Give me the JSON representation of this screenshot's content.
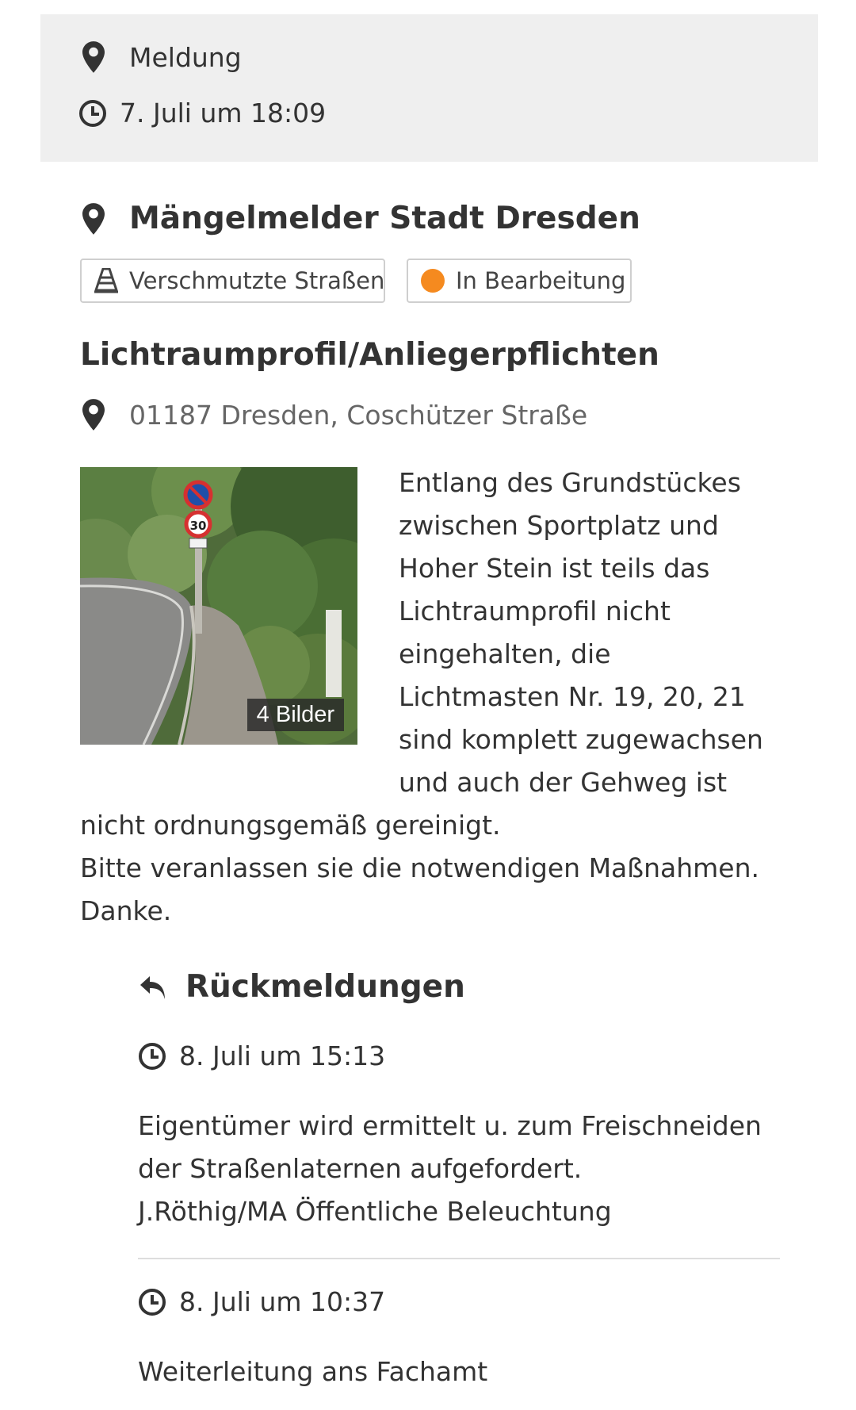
{
  "header": {
    "type_label": "Meldung",
    "type_icon": "map-pin-icon",
    "date": "7. Juli um 18:09",
    "date_icon": "clock-icon"
  },
  "org": {
    "name": "Mängelmelder Stadt Dresden",
    "icon": "map-pin-icon"
  },
  "tags": {
    "category": {
      "label": "Verschmutzte Straßen",
      "icon": "traffic-cone-icon"
    },
    "status": {
      "label": "In Bearbeitung",
      "color": "#f58a1f"
    }
  },
  "report": {
    "title": "Lichtraumprofil/Anliegerpflichten",
    "address": "01187 Dresden, Coschützer Straße",
    "photo_badge": "4 Bilder",
    "description_p1": "Entlang des Grundstückes zwischen Sportplatz und Hoher Stein ist teils das Lichtraumprofil nicht eingehalten, die Lichtmasten Nr. 19, 20, 21 sind komplett zugewachsen und auch der Gehweg ist nicht ordnungsgemäß gereinigt.",
    "description_p2": "Bitte veranlassen sie die notwendigen Maßnahmen.",
    "description_p3": "Danke."
  },
  "feedback": {
    "heading": "Rückmeldungen",
    "heading_icon": "reply-icon",
    "entries": [
      {
        "date": "8. Juli um 15:13",
        "line1": "Eigentümer wird ermittelt u. zum Freischneiden der Straßenlaternen aufgefordert.",
        "line2": "J.Röthig/MA Öffentliche Beleuchtung"
      },
      {
        "date": "8. Juli um 10:37",
        "line1": "Weiterleitung ans Fachamt"
      }
    ]
  }
}
